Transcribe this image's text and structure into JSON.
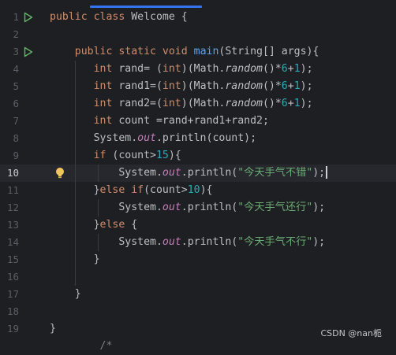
{
  "editor": {
    "lines": [
      {
        "n": "1",
        "code": [
          [
            "kw",
            "public "
          ],
          [
            "kw",
            "class "
          ],
          [
            "",
            "Welcome {"
          ]
        ],
        "run": true
      },
      {
        "n": "2",
        "code": []
      },
      {
        "n": "3",
        "code": [
          [
            "",
            "    "
          ],
          [
            "kw",
            "public "
          ],
          [
            "kw",
            "static "
          ],
          [
            "kw",
            "void "
          ],
          [
            "fn",
            "main"
          ],
          [
            "",
            "(String[] args){"
          ]
        ],
        "run": true
      },
      {
        "n": "4",
        "code": [
          [
            "",
            "       "
          ],
          [
            "kw",
            "int "
          ],
          [
            "",
            "rand= ("
          ],
          [
            "kw",
            "int"
          ],
          [
            "",
            ")(Math."
          ],
          [
            "it",
            "random"
          ],
          [
            "",
            "()*"
          ],
          [
            "num",
            "6"
          ],
          [
            "",
            "+"
          ],
          [
            "num",
            "1"
          ],
          [
            "",
            ");"
          ]
        ]
      },
      {
        "n": "5",
        "code": [
          [
            "",
            "       "
          ],
          [
            "kw",
            "int "
          ],
          [
            "",
            "rand1=("
          ],
          [
            "kw",
            "int"
          ],
          [
            "",
            ")(Math."
          ],
          [
            "it",
            "random"
          ],
          [
            "",
            "()*"
          ],
          [
            "num",
            "6"
          ],
          [
            "",
            "+"
          ],
          [
            "num",
            "1"
          ],
          [
            "",
            ");"
          ]
        ]
      },
      {
        "n": "6",
        "code": [
          [
            "",
            "       "
          ],
          [
            "kw",
            "int "
          ],
          [
            "",
            "rand2=("
          ],
          [
            "kw",
            "int"
          ],
          [
            "",
            ")(Math."
          ],
          [
            "it",
            "random"
          ],
          [
            "",
            "()*"
          ],
          [
            "num",
            "6"
          ],
          [
            "",
            "+"
          ],
          [
            "num",
            "1"
          ],
          [
            "",
            ");"
          ]
        ]
      },
      {
        "n": "7",
        "code": [
          [
            "",
            "       "
          ],
          [
            "kw",
            "int "
          ],
          [
            "",
            "count =rand+rand1+rand2;"
          ]
        ]
      },
      {
        "n": "8",
        "code": [
          [
            "",
            "       System."
          ],
          [
            "field",
            "out"
          ],
          [
            "",
            ".println(count);"
          ]
        ]
      },
      {
        "n": "9",
        "code": [
          [
            "",
            "       "
          ],
          [
            "kw",
            "if "
          ],
          [
            "",
            "(count>"
          ],
          [
            "num",
            "15"
          ],
          [
            "",
            "){"
          ]
        ]
      },
      {
        "n": "10",
        "code": [
          [
            "",
            "           System."
          ],
          [
            "field",
            "out"
          ],
          [
            "",
            ".println("
          ],
          [
            "str",
            "\"今天手气不错\""
          ],
          [
            "",
            ");"
          ]
        ],
        "current": true,
        "bulb": true
      },
      {
        "n": "11",
        "code": [
          [
            "",
            "       }"
          ],
          [
            "kw",
            "else if"
          ],
          [
            "",
            "(count>"
          ],
          [
            "num",
            "10"
          ],
          [
            "",
            "){"
          ]
        ]
      },
      {
        "n": "12",
        "code": [
          [
            "",
            "           System."
          ],
          [
            "field",
            "out"
          ],
          [
            "",
            ".println("
          ],
          [
            "str",
            "\"今天手气还行\""
          ],
          [
            "",
            ");"
          ]
        ]
      },
      {
        "n": "13",
        "code": [
          [
            "",
            "       }"
          ],
          [
            "kw",
            "else "
          ],
          [
            "",
            "{"
          ]
        ]
      },
      {
        "n": "14",
        "code": [
          [
            "",
            "           System."
          ],
          [
            "field",
            "out"
          ],
          [
            "",
            ".println("
          ],
          [
            "str",
            "\"今天手气不行\""
          ],
          [
            "",
            ");"
          ]
        ]
      },
      {
        "n": "15",
        "code": [
          [
            "",
            "       }"
          ]
        ]
      },
      {
        "n": "16",
        "code": []
      },
      {
        "n": "17",
        "code": [
          [
            "",
            "    }"
          ]
        ]
      },
      {
        "n": "18",
        "code": []
      },
      {
        "n": "19",
        "code": [
          [
            "",
            "}"
          ]
        ]
      },
      {
        "n": "",
        "code": [
          [
            "comment",
            "        /*"
          ]
        ]
      }
    ]
  },
  "watermark": "CSDN @nan栀",
  "colors": {
    "background": "#1e1f22",
    "keyword": "#cf8e6d",
    "number": "#2aacb8",
    "method": "#56a8f5",
    "field": "#c77dbb",
    "string": "#6aab73",
    "run_icon": "#5fb865",
    "bulb_icon": "#f2c55c"
  }
}
